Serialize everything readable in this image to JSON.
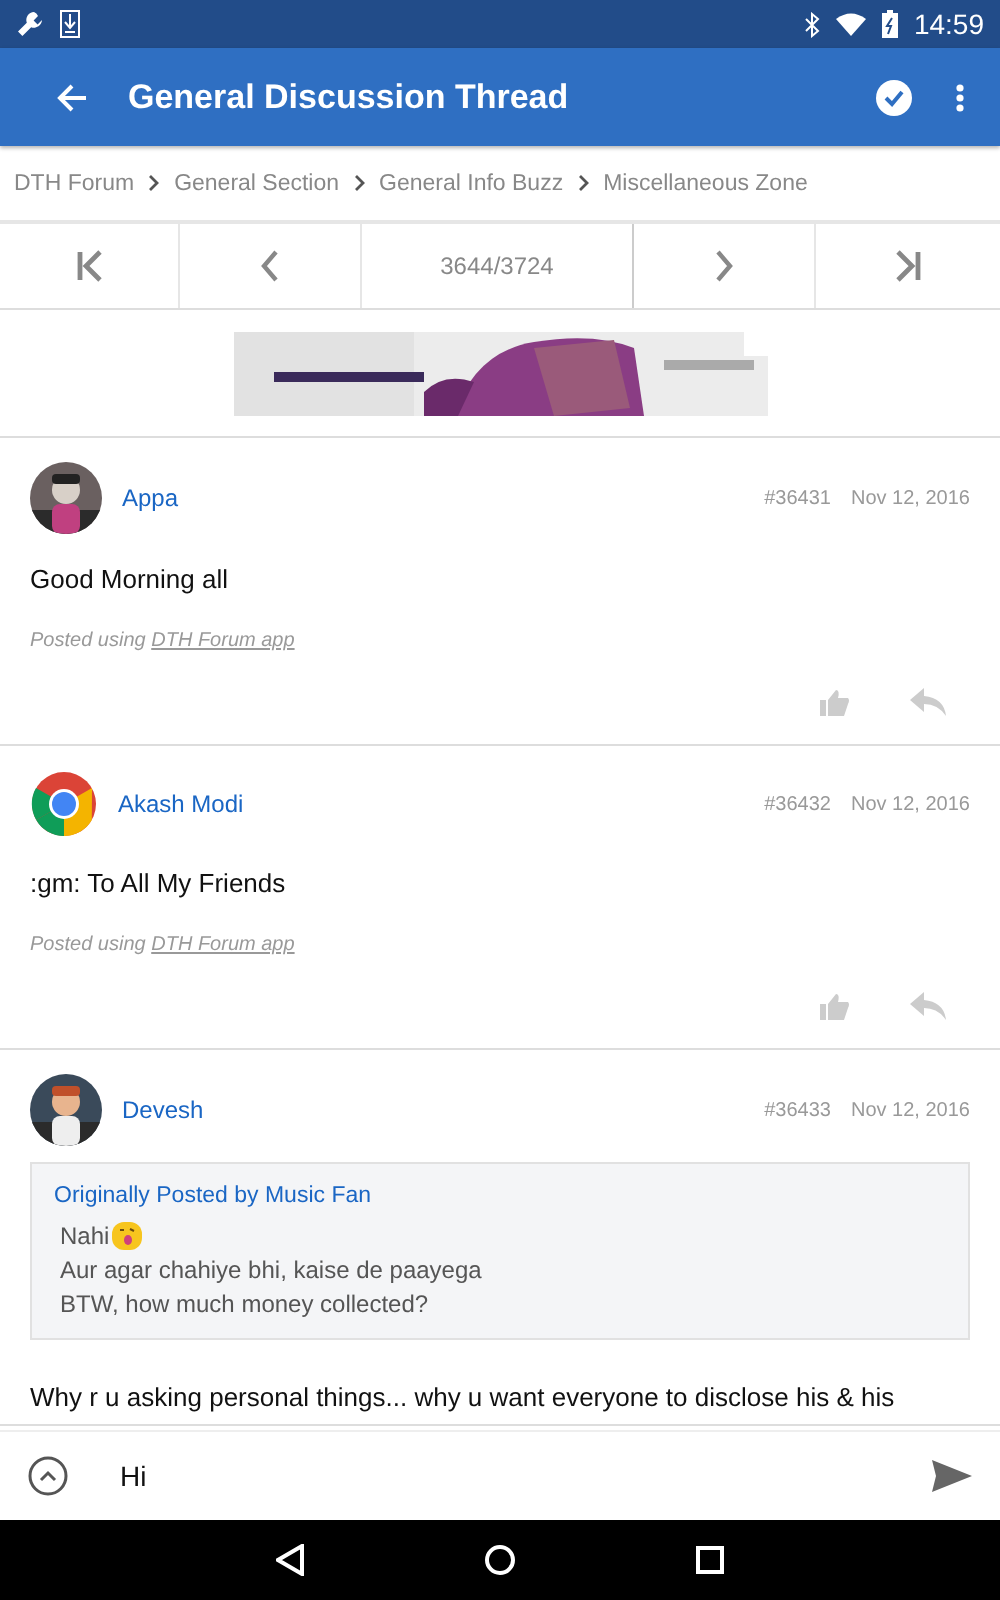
{
  "status_bar": {
    "time": "14:59"
  },
  "app_bar": {
    "title": "General Discussion Thread"
  },
  "breadcrumbs": [
    "DTH Forum",
    "General Section",
    "General Info Buzz",
    "Miscellaneous Zone"
  ],
  "pager": {
    "page": "3644/3724"
  },
  "posts": [
    {
      "author": "Appa",
      "number": "#36431",
      "date": "Nov 12, 2016",
      "body": "Good Morning all",
      "signature_prefix": "Posted using",
      "signature_link": "DTH Forum app"
    },
    {
      "author": "Akash Modi",
      "kind": "logo",
      "number": "#36432",
      "date": "Nov 12, 2016",
      "body": ":gm: To All My Friends",
      "signature_prefix": "Posted using",
      "signature_link": "DTH Forum app"
    },
    {
      "author": "Devesh",
      "kind": "cartoon",
      "number": "#36433",
      "date": "Nov 12, 2016",
      "quote": {
        "by": "Originally Posted by Music Fan",
        "lines": [
          "Nahi",
          "Aur agar chahiye bhi, kaise de paayega",
          "BTW, how much money collected?"
        ]
      },
      "body": "Why r u asking personal things... why u want everyone to disclose his & his"
    }
  ],
  "reply": {
    "value": "Hi"
  }
}
